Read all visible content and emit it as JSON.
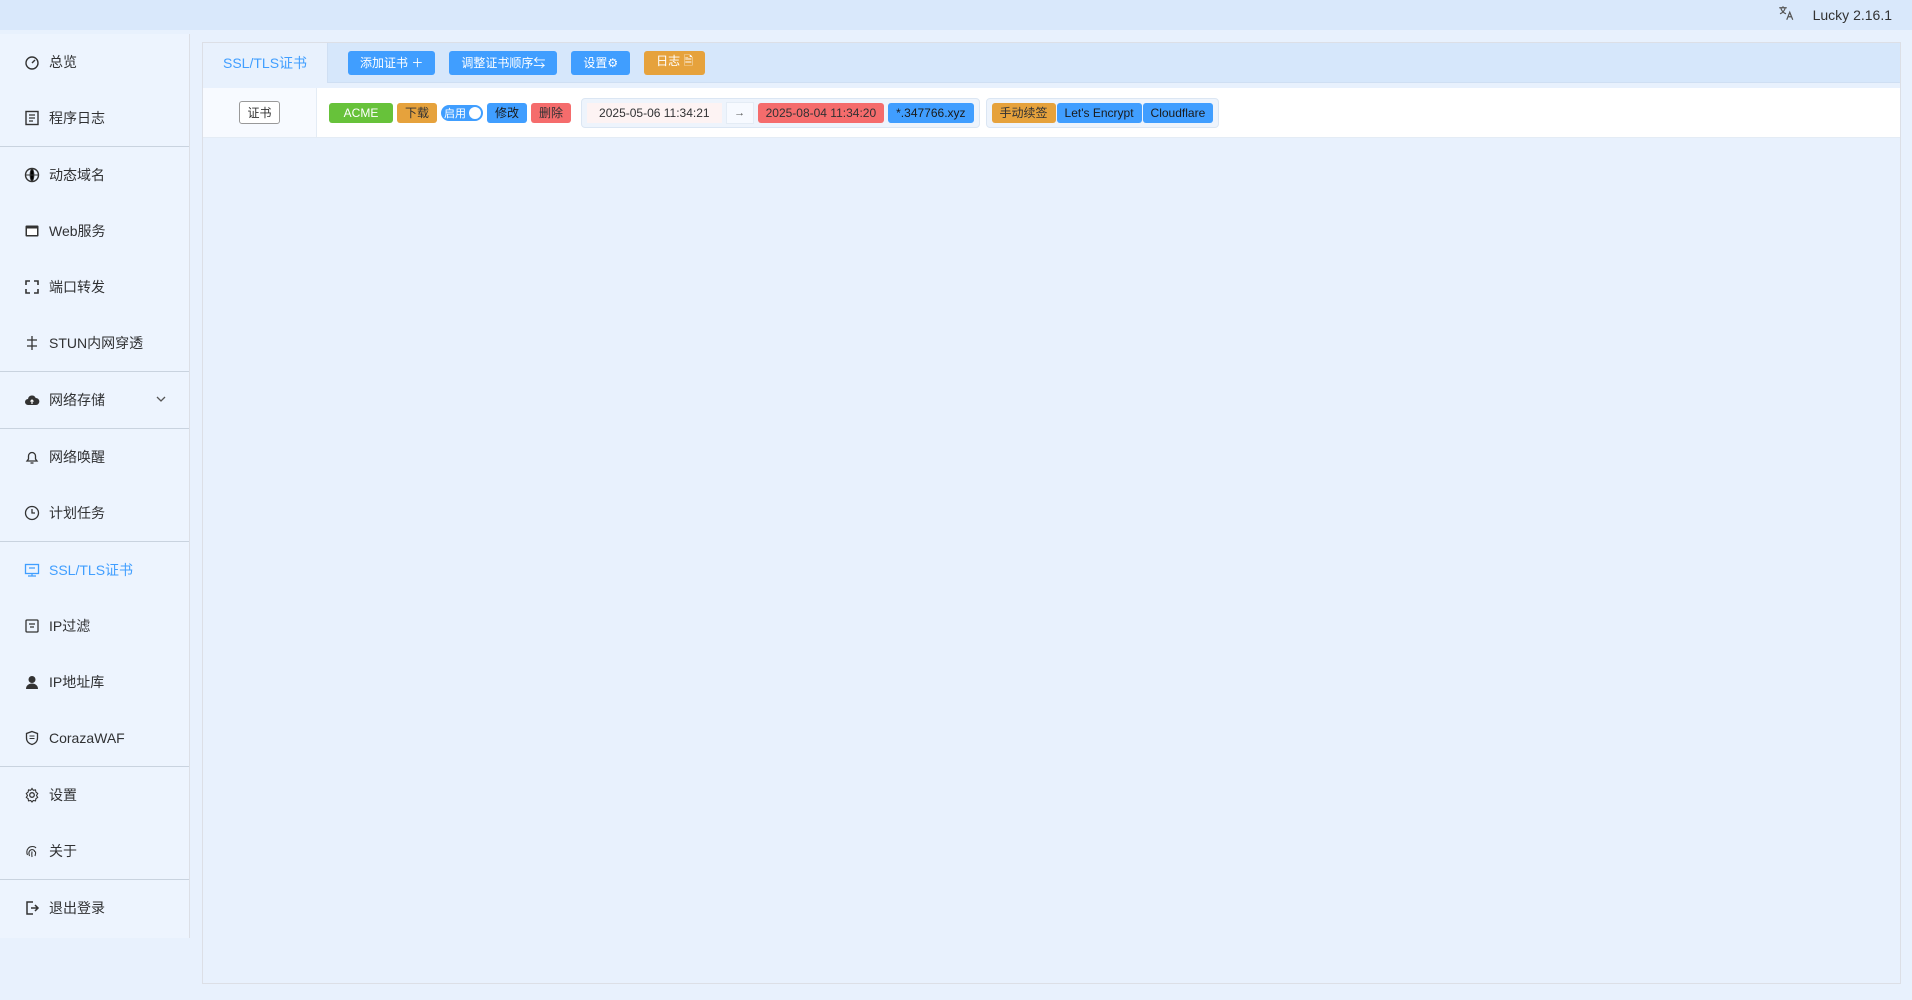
{
  "header": {
    "lang_icon": "translate-icon",
    "version": "Lucky 2.16.1"
  },
  "sidebar": {
    "groups": [
      [
        {
          "label": "总览",
          "icon": "dashboard-icon"
        },
        {
          "label": "程序日志",
          "icon": "log-icon"
        }
      ],
      [
        {
          "label": "动态域名",
          "icon": "dns-icon"
        },
        {
          "label": "Web服务",
          "icon": "web-icon"
        },
        {
          "label": "端口转发",
          "icon": "port-forward-icon"
        },
        {
          "label": "STUN内网穿透",
          "icon": "stun-icon"
        }
      ],
      [
        {
          "label": "网络存储",
          "icon": "cloud-upload-icon"
        }
      ],
      [
        {
          "label": "网络唤醒",
          "icon": "bell-icon"
        },
        {
          "label": "计划任务",
          "icon": "clock-icon"
        }
      ],
      [
        {
          "label": "SSL/TLS证书",
          "icon": "certificate-icon"
        },
        {
          "label": "IP过滤",
          "icon": "filter-icon"
        },
        {
          "label": "IP地址库",
          "icon": "location-icon"
        },
        {
          "label": "CorazaWAF",
          "icon": "shield-icon"
        }
      ],
      [
        {
          "label": "设置",
          "icon": "gear-icon"
        },
        {
          "label": "关于",
          "icon": "fingerprint-icon"
        }
      ],
      [
        {
          "label": "退出登录",
          "icon": "logout-icon"
        }
      ]
    ],
    "active": "SSL/TLS证书"
  },
  "main": {
    "tab": "SSL/TLS证书",
    "toolbar": {
      "add": "添加证书 ＋",
      "reorder": "调整证书顺序⇆",
      "settings": "设置⚙",
      "log": "日志 🗎"
    },
    "row": {
      "type": "证书",
      "mode": "ACME",
      "download": "下载",
      "enabled_label": "启用",
      "edit": "修改",
      "delete": "删除",
      "start_date": "2025-05-06 11:34:21",
      "arrow": "→",
      "end_date": "2025-08-04 11:34:20",
      "domain": "*.347766.xyz",
      "renew": "手动续签",
      "ca": "Let's Encrypt",
      "dns": "Cloudflare"
    }
  },
  "colors": {
    "primary": "#409eff",
    "success": "#67c23a",
    "warning": "#e6a23c",
    "danger": "#f56c6c"
  }
}
